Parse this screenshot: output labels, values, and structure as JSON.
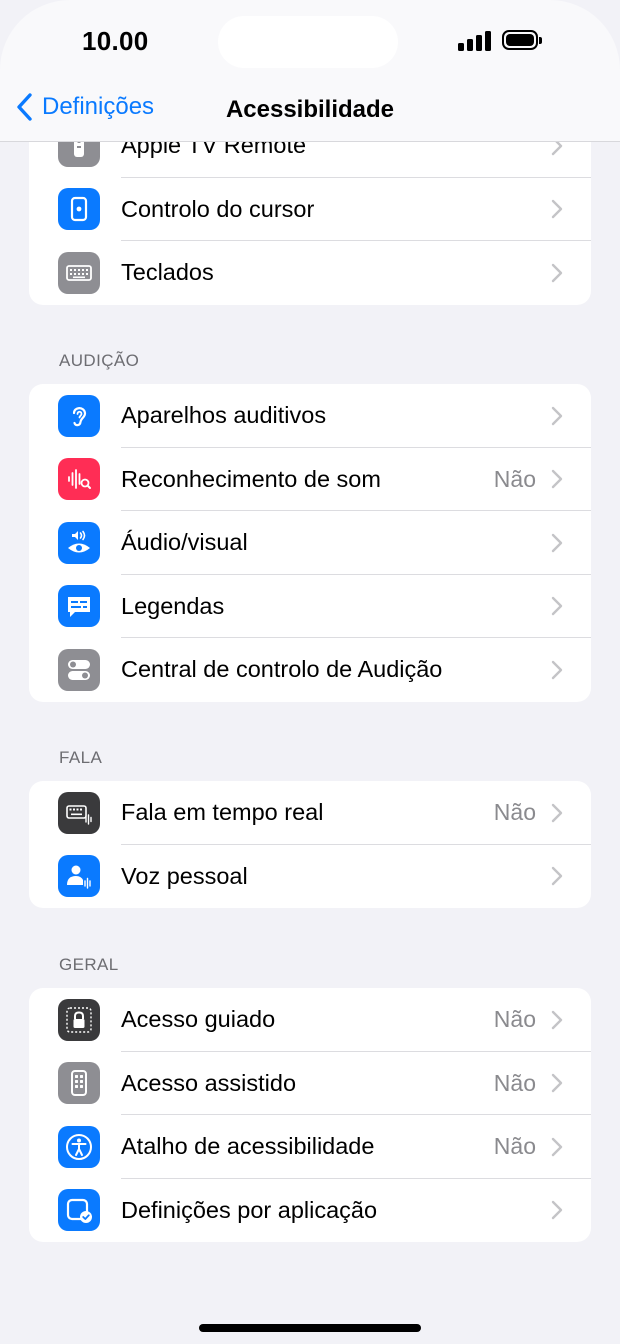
{
  "status": {
    "time": "10.00"
  },
  "nav": {
    "back_label": "Definições",
    "title": "Acessibilidade"
  },
  "colors": {
    "accent": "#0a7aff",
    "gray_icon": "#8e8e93",
    "pink_icon": "#ff2d55",
    "dark_icon": "#3a3a3c"
  },
  "groups": {
    "interaction": {
      "rows": [
        {
          "label": "Apple TV Remote",
          "value": "",
          "icon": "tv-remote-icon"
        },
        {
          "label": "Controlo do cursor",
          "value": "",
          "icon": "cursor-control-icon"
        },
        {
          "label": "Teclados",
          "value": "",
          "icon": "keyboard-icon"
        }
      ]
    },
    "hearing": {
      "header": "AUDIÇÃO",
      "rows": [
        {
          "label": "Aparelhos auditivos",
          "value": "",
          "icon": "ear-icon"
        },
        {
          "label": "Reconhecimento de som",
          "value": "Não",
          "icon": "sound-recognition-icon"
        },
        {
          "label": "Áudio/visual",
          "value": "",
          "icon": "audio-visual-icon"
        },
        {
          "label": "Legendas",
          "value": "",
          "icon": "subtitles-icon"
        },
        {
          "label": "Central de controlo de Audição",
          "value": "",
          "icon": "toggles-icon"
        }
      ]
    },
    "speech": {
      "header": "FALA",
      "rows": [
        {
          "label": "Fala em tempo real",
          "value": "Não",
          "icon": "live-speech-icon"
        },
        {
          "label": "Voz pessoal",
          "value": "",
          "icon": "personal-voice-icon"
        }
      ]
    },
    "general": {
      "header": "GERAL",
      "rows": [
        {
          "label": "Acesso guiado",
          "value": "Não",
          "icon": "lock-icon"
        },
        {
          "label": "Acesso assistido",
          "value": "Não",
          "icon": "assistive-access-icon"
        },
        {
          "label": "Atalho de acessibilidade",
          "value": "Não",
          "icon": "accessibility-icon"
        },
        {
          "label": "Definições por aplicação",
          "value": "",
          "icon": "per-app-settings-icon"
        }
      ]
    }
  }
}
